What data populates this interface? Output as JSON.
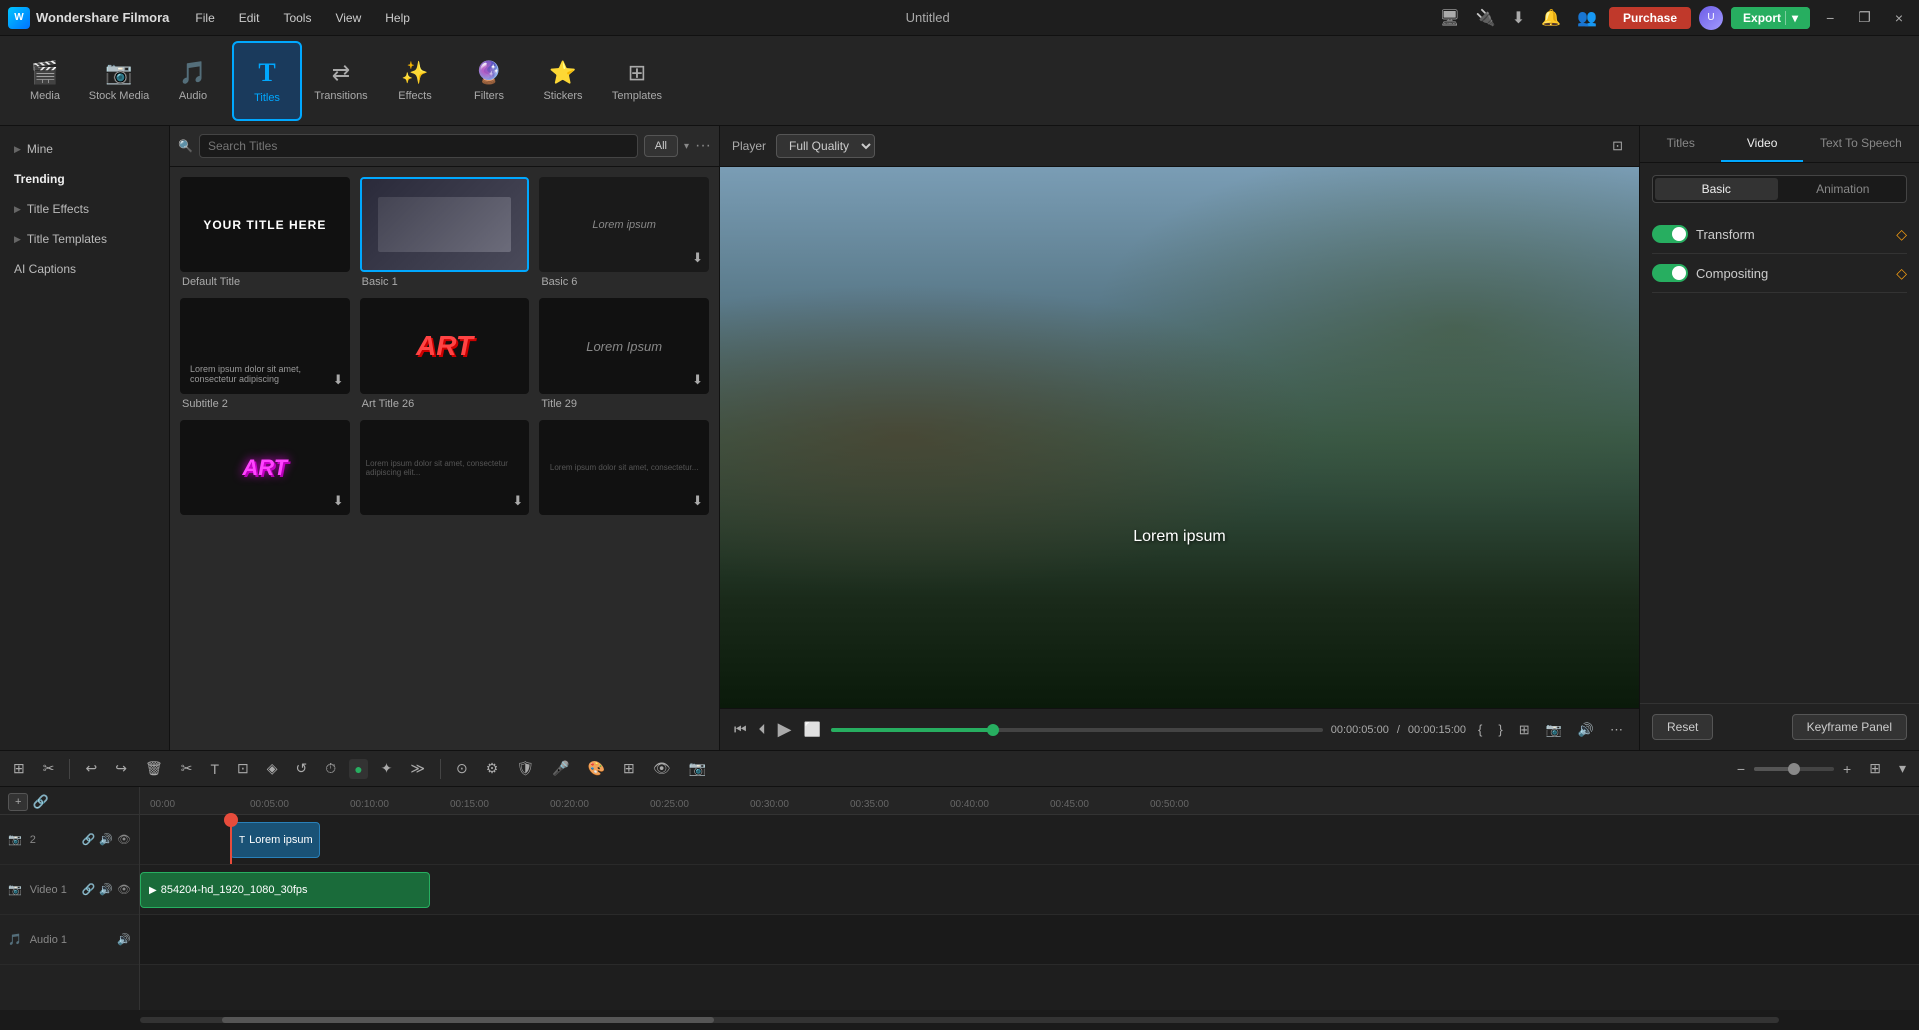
{
  "app": {
    "name": "Wondershare Filmora",
    "title": "Untitled"
  },
  "titlebar": {
    "menu": [
      "File",
      "Edit",
      "Tools",
      "View",
      "Help"
    ],
    "purchase_label": "Purchase",
    "export_label": "Export",
    "window_buttons": [
      "−",
      "❐",
      "×"
    ]
  },
  "toolbar": {
    "items": [
      {
        "id": "media",
        "label": "Media",
        "icon": "🎬"
      },
      {
        "id": "stock_media",
        "label": "Stock Media",
        "icon": "📷"
      },
      {
        "id": "audio",
        "label": "Audio",
        "icon": "🎵"
      },
      {
        "id": "titles",
        "label": "Titles",
        "icon": "T",
        "active": true
      },
      {
        "id": "transitions",
        "label": "Transitions",
        "icon": "⇄"
      },
      {
        "id": "effects",
        "label": "Effects",
        "icon": "✨"
      },
      {
        "id": "filters",
        "label": "Filters",
        "icon": "🔮"
      },
      {
        "id": "stickers",
        "label": "Stickers",
        "icon": "⭐"
      },
      {
        "id": "templates",
        "label": "Templates",
        "icon": "⊞"
      }
    ]
  },
  "sidebar": {
    "items": [
      {
        "id": "mine",
        "label": "Mine",
        "has_arrow": true
      },
      {
        "id": "trending",
        "label": "Trending",
        "active": true
      },
      {
        "id": "title_effects",
        "label": "Title Effects",
        "has_arrow": true
      },
      {
        "id": "title_templates",
        "label": "Title Templates",
        "has_arrow": true
      },
      {
        "id": "ai_captions",
        "label": "AI Captions"
      }
    ]
  },
  "search": {
    "placeholder": "Search Titles",
    "filter": "All"
  },
  "grid": {
    "items": [
      {
        "id": "default_title",
        "label": "Default Title",
        "content": "YOUR TITLE HERE",
        "type": "default"
      },
      {
        "id": "basic1",
        "label": "Basic 1",
        "type": "image",
        "selected": true
      },
      {
        "id": "basic6",
        "label": "Basic 6",
        "content": "Lorem ipsum",
        "type": "text_plain"
      },
      {
        "id": "subtitle2",
        "label": "Subtitle 2",
        "type": "subtitle"
      },
      {
        "id": "art_title26",
        "label": "Art Title 26",
        "content": "ART",
        "type": "art_red"
      },
      {
        "id": "title29",
        "label": "Title 29",
        "content": "Lorem Ipsum",
        "type": "title29"
      },
      {
        "id": "art_pink",
        "label": "",
        "type": "art_pink",
        "content": "ART"
      },
      {
        "id": "grid7",
        "label": "",
        "type": "dark_text"
      },
      {
        "id": "grid8",
        "label": "",
        "type": "dark_text2"
      }
    ]
  },
  "preview": {
    "label": "Player",
    "quality": "Full Quality",
    "overlay_text": "Lorem ipsum",
    "current_time": "00:00:05:00",
    "total_time": "00:00:15:00",
    "progress_pct": 33
  },
  "right_panel": {
    "tabs": [
      "Titles",
      "Video",
      "Text To Speech"
    ],
    "active_tab": "Video",
    "subtabs": [
      "Basic",
      "Animation"
    ],
    "active_subtab": "Basic",
    "sections": [
      {
        "id": "transform",
        "label": "Transform",
        "enabled": true
      },
      {
        "id": "compositing",
        "label": "Compositing",
        "enabled": true
      }
    ],
    "reset_label": "Reset",
    "keyframe_label": "Keyframe Panel"
  },
  "timeline": {
    "toolbar_buttons": [
      "⊞",
      "✂",
      "↩",
      "↪",
      "🗑",
      "✂",
      "T",
      "⊡",
      "◈",
      "↺",
      "⏱",
      "◇",
      "📋"
    ],
    "ruler_marks": [
      "00:00",
      "00:05:00",
      "00:10:00",
      "00:15:00",
      "00:20:00",
      "00:25:00",
      "00:30:00",
      "00:35:00",
      "00:40:00",
      "00:45:00",
      "00:50:00"
    ],
    "tracks": [
      {
        "id": "track2",
        "label": "2",
        "icons": [
          "📷",
          "🔊",
          "👁"
        ]
      },
      {
        "id": "video1",
        "label": "Video 1",
        "icons": [
          "📷",
          "🔊",
          "👁"
        ]
      },
      {
        "id": "audio1",
        "label": "Audio 1",
        "icons": [
          "🎵"
        ]
      }
    ],
    "clips": [
      {
        "id": "title_clip",
        "label": "Lorem ipsum",
        "track": "track2",
        "type": "title"
      },
      {
        "id": "video_clip",
        "label": "854204-hd_1920_1080_30fps",
        "track": "video1",
        "type": "video"
      }
    ]
  }
}
